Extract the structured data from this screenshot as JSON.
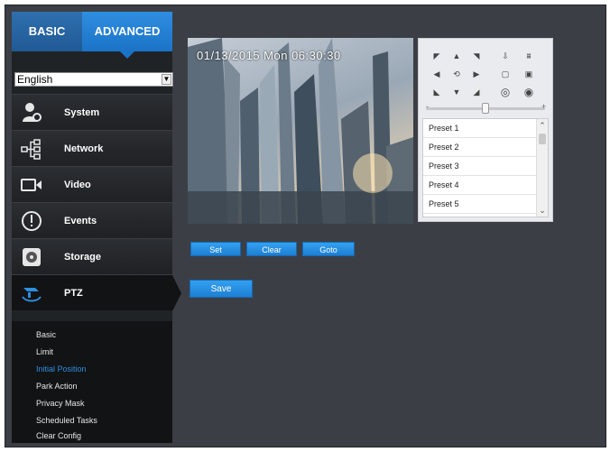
{
  "tabs": {
    "basic": "BASIC",
    "advanced": "ADVANCED"
  },
  "language": {
    "selected": "English"
  },
  "menu": [
    {
      "id": "system",
      "label": "System",
      "icon": "user-gear-icon"
    },
    {
      "id": "network",
      "label": "Network",
      "icon": "network-icon"
    },
    {
      "id": "video",
      "label": "Video",
      "icon": "video-camera-icon"
    },
    {
      "id": "events",
      "label": "Events",
      "icon": "alert-icon"
    },
    {
      "id": "storage",
      "label": "Storage",
      "icon": "disk-icon"
    },
    {
      "id": "ptz",
      "label": "PTZ",
      "icon": "ptz-camera-icon",
      "active": true
    }
  ],
  "submenu": [
    {
      "label": "Basic"
    },
    {
      "label": "Limit"
    },
    {
      "label": "Initial Position",
      "active": true
    },
    {
      "label": "Park Action"
    },
    {
      "label": "Privacy Mask"
    },
    {
      "label": "Scheduled Tasks"
    },
    {
      "label": "Clear Config"
    }
  ],
  "preview": {
    "timestamp": "01/13/2015 Mon 06:30:30"
  },
  "ptz_controls": {
    "arrows": [
      "up-left",
      "up",
      "up-right",
      "left",
      "home",
      "right",
      "down-left",
      "down",
      "down-right"
    ],
    "zoom_focus": [
      "focus-icon",
      "auto-focus-icon",
      "zoom-in-icon",
      "zoom-out-icon",
      "iris-open-icon",
      "iris-close-icon"
    ]
  },
  "presets": [
    "Preset 1",
    "Preset 2",
    "Preset 3",
    "Preset 4",
    "Preset 5"
  ],
  "buttons": {
    "set": "Set",
    "clear": "Clear",
    "goto": "Goto",
    "save": "Save"
  },
  "colors": {
    "accent": "#1d7fd3",
    "panel_bg": "#3b3f45",
    "sidebar_bg": "#202326",
    "active_sub": "#2f8ee0"
  }
}
